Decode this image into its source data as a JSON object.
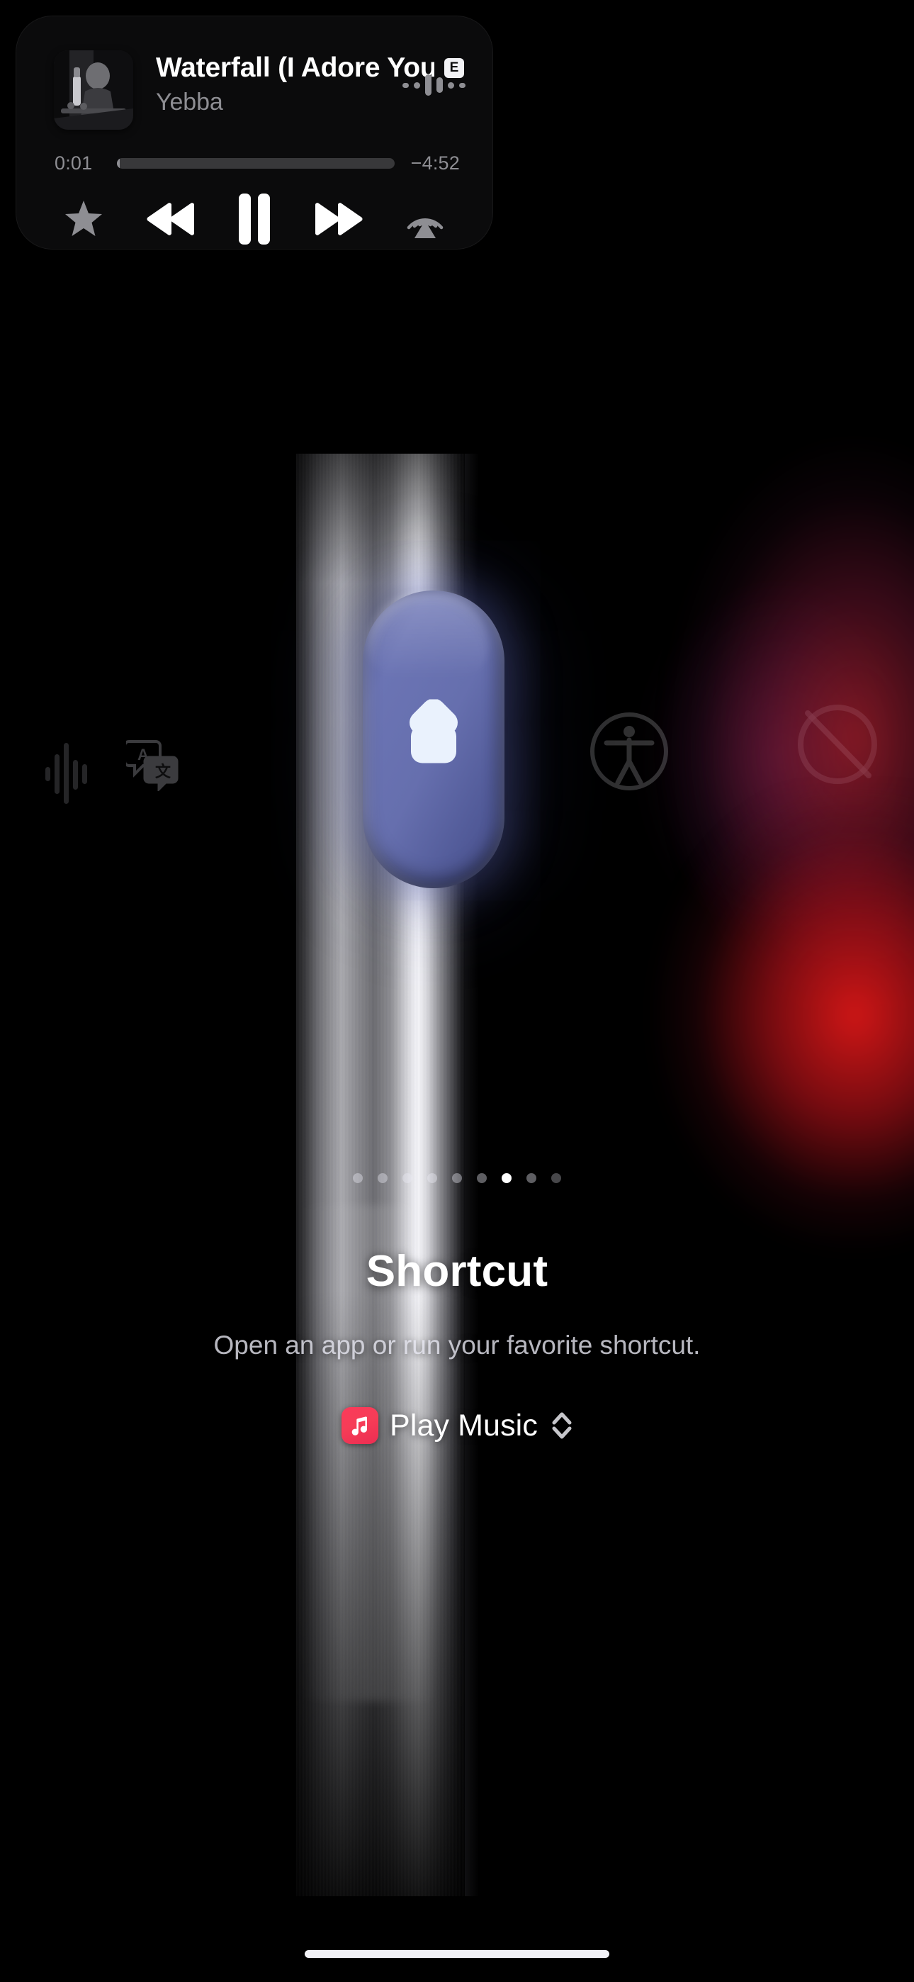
{
  "now_playing": {
    "title": "Waterfall (I Adore You)",
    "artist": "Yebba",
    "explicit_badge": "E",
    "elapsed": "0:01",
    "remaining": "−4:52",
    "progress_percent": 0.4,
    "artwork_alt": "album-artwork",
    "controls": [
      {
        "name": "favorite-button",
        "icon": "star-icon",
        "state": "inactive"
      },
      {
        "name": "rewind-button",
        "icon": "rewind-icon",
        "state": "active"
      },
      {
        "name": "play-pause-button",
        "icon": "pause-icon",
        "state": "active"
      },
      {
        "name": "fast-forward-button",
        "icon": "fast-forward-icon",
        "state": "active"
      },
      {
        "name": "airplay-button",
        "icon": "airplay-icon",
        "state": "inactive"
      }
    ],
    "visualizer_bars": [
      7,
      9,
      30,
      22,
      9,
      7
    ]
  },
  "action_button": {
    "option_title": "Shortcut",
    "option_description": "Open an app or run your favorite shortcut.",
    "button_icon": "shortcuts-icon",
    "button_color": "#666FAE",
    "page_dots": {
      "total": 9,
      "active_index": 6
    },
    "selector": {
      "app_icon": "apple-music-icon",
      "app_icon_color": "#F63D57",
      "label": "Play Music",
      "chevron": "chevron-up-down-icon"
    },
    "neighbor_icons": [
      {
        "name": "waveform-icon",
        "label": "voice-memo"
      },
      {
        "name": "translate-icon",
        "label": "translate"
      },
      {
        "name": "accessibility-icon",
        "label": "accessibility"
      },
      {
        "name": "silent-mode-icon",
        "label": "silent-mode"
      }
    ]
  },
  "system": {
    "home_indicator": "home-indicator"
  }
}
